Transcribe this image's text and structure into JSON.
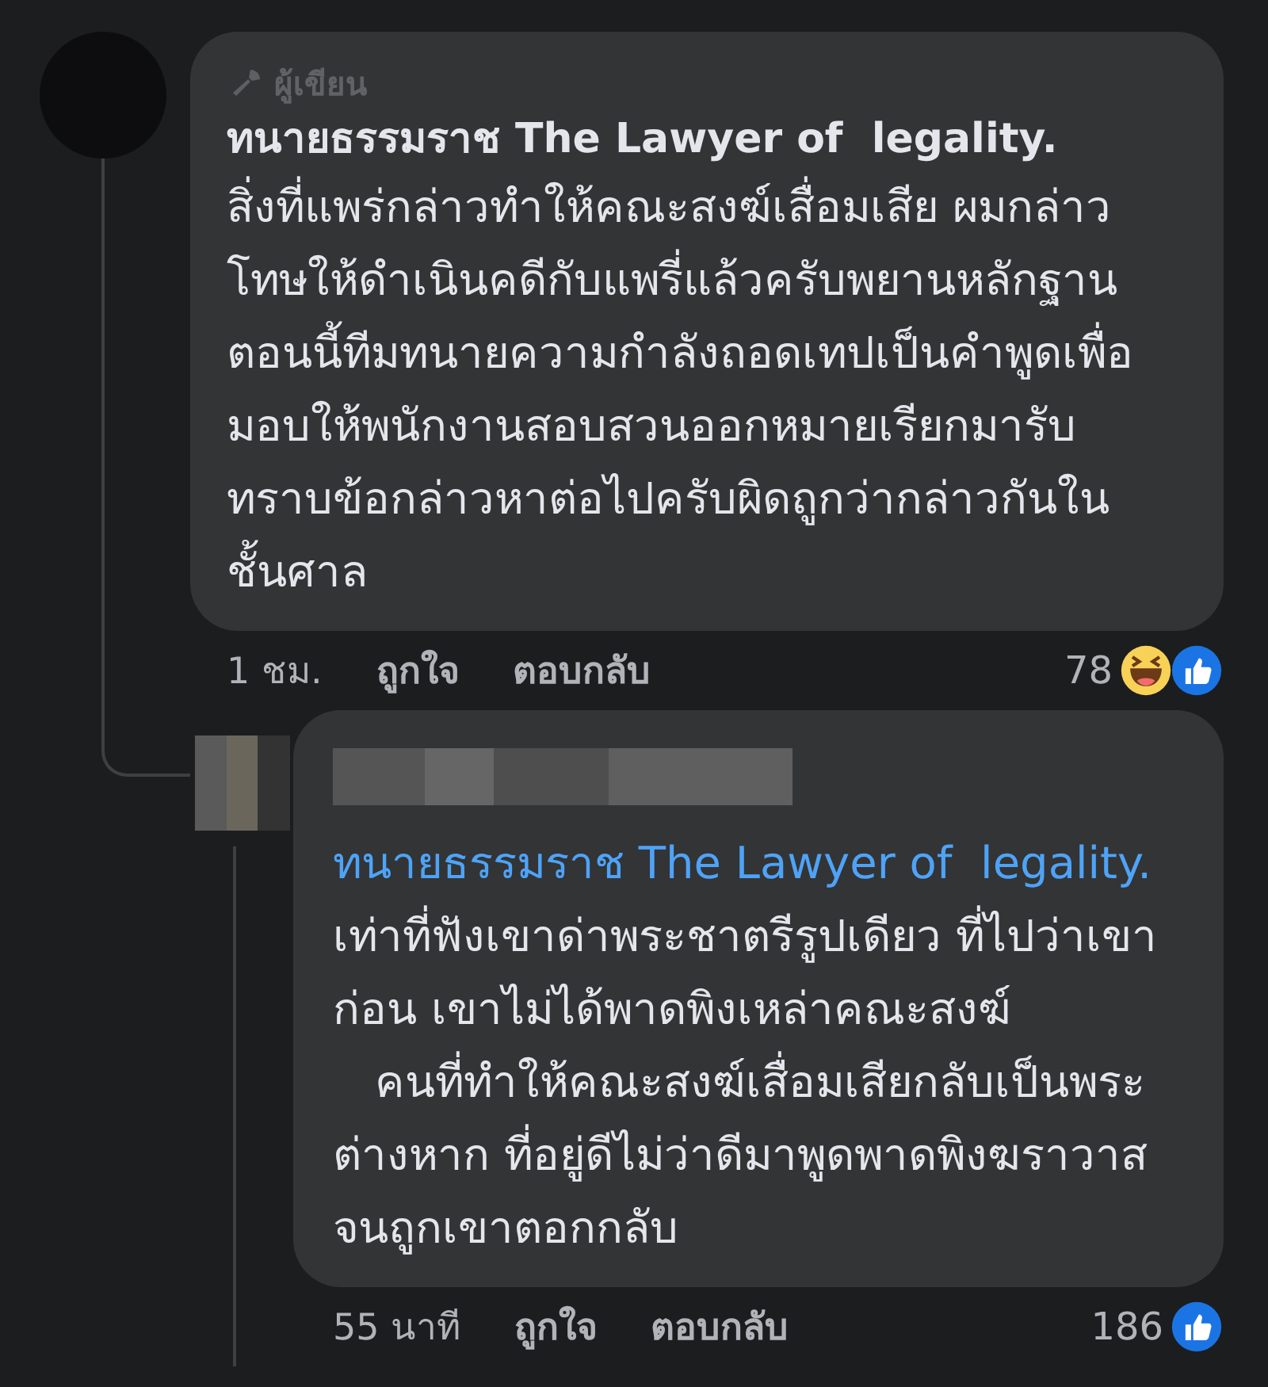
{
  "comments": [
    {
      "badge": "ผู้เขียน",
      "author": "ทนายธรรมราช The Lawyer of  legality.",
      "lines": [
        "สิ่งที่แพร่กล่าวทำให้คณะสงฆ์เสื่อมเสีย ผมกล่าว",
        "โทษให้ดำเนินคดีกับแพรี่แล้วครับพยานหลักฐาน",
        "ตอนนี้ทีมทนายความกำลังถอดเทปเป็นคำพูดเพื่อ",
        "มอบให้พนักงานสอบสวนออกหมายเรียกมารับ",
        "ทราบข้อกล่าวหาต่อไปครับผิดถูกว่ากล่าวกันใน",
        "ชั้นศาล"
      ],
      "time": "1 ชม.",
      "like": "ถูกใจ",
      "reply": "ตอบกลับ",
      "count": "78",
      "reactions": [
        {
          "kind": "haha"
        },
        {
          "kind": "like"
        }
      ],
      "replies": [
        {
          "mention": "ทนายธรรมราช The Lawyer of  legality.",
          "lines": [
            "เท่าที่ฟังเขาด่าพระชาตรีรูปเดียว ที่ไปว่าเขา",
            "ก่อน เขาไม่ได้พาดพิงเหล่าคณะสงฆ์",
            "   คนที่ทำให้คณะสงฆ์เสื่อมเสียกลับเป็นพระ",
            "ต่างหาก ที่อยู่ดีไม่ว่าดีมาพูดพาดพิงฆราวาส",
            "จนถูกเขาตอกกลับ"
          ],
          "time": "55 นาที",
          "like": "ถูกใจ",
          "reply": "ตอบกลับ",
          "count": "186",
          "reactions": [
            {
              "kind": "like"
            }
          ]
        }
      ]
    }
  ]
}
